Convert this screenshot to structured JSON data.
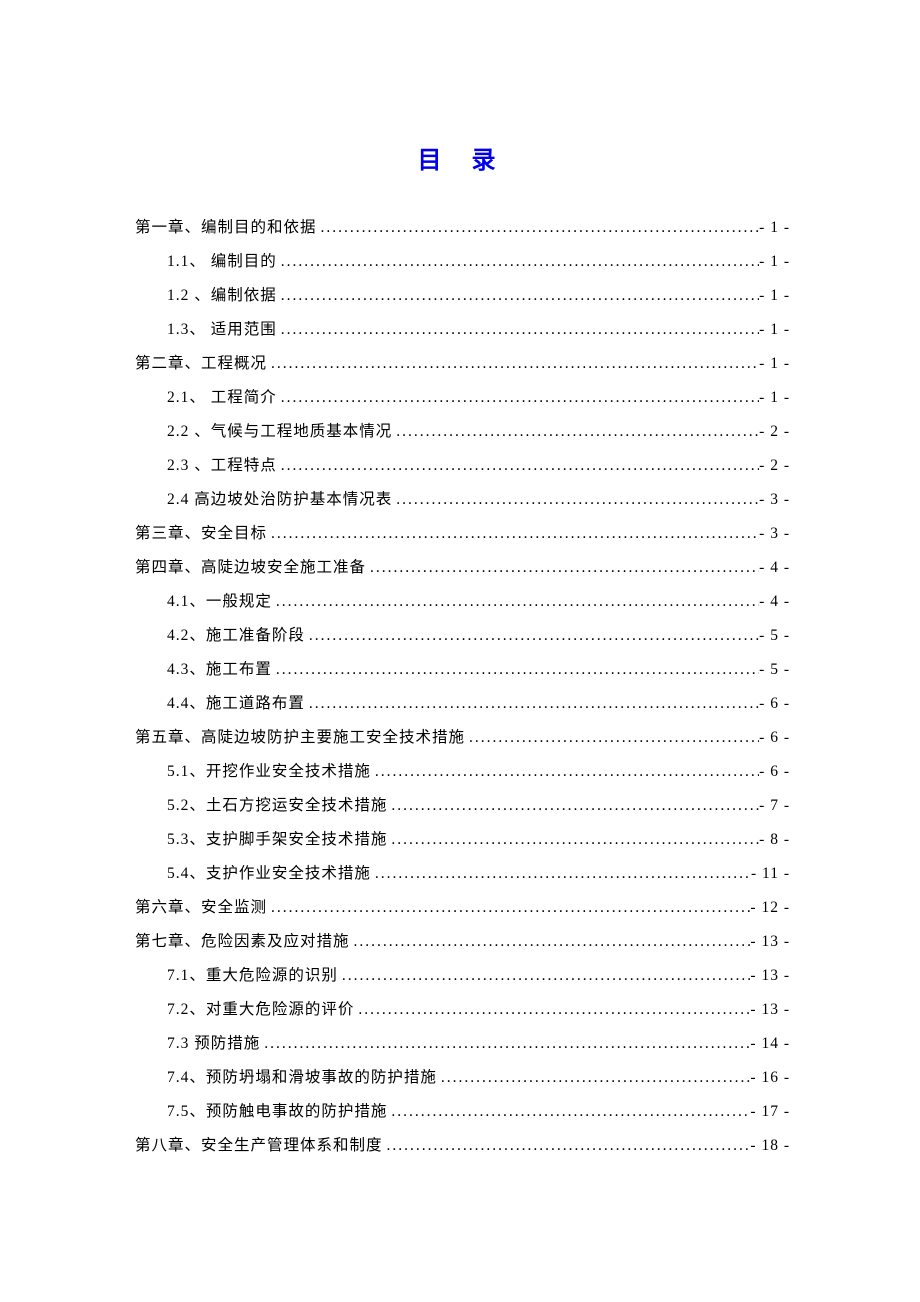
{
  "title": "目 录",
  "entries": [
    {
      "level": 1,
      "label": "第一章、编制目的和依据",
      "page": "- 1 -"
    },
    {
      "level": 2,
      "label": "1.1、 编制目的",
      "page": "- 1 -"
    },
    {
      "level": 2,
      "label": "1.2 、编制依据",
      "page": "- 1 -"
    },
    {
      "level": 2,
      "label": "1.3、 适用范围",
      "page": "- 1 -"
    },
    {
      "level": 1,
      "label": "第二章、工程概况",
      "page": "- 1 -"
    },
    {
      "level": 2,
      "label": "2.1、 工程简介",
      "page": "- 1 -"
    },
    {
      "level": 2,
      "label": "2.2 、气候与工程地质基本情况",
      "page": "- 2 -"
    },
    {
      "level": 2,
      "label": "2.3 、工程特点",
      "page": "- 2 -"
    },
    {
      "level": 2,
      "label": "2.4 高边坡处治防护基本情况表",
      "page": "- 3 -"
    },
    {
      "level": 1,
      "label": "第三章、安全目标",
      "page": "- 3 -"
    },
    {
      "level": 1,
      "label": "第四章、高陡边坡安全施工准备",
      "page": "- 4 -"
    },
    {
      "level": 2,
      "label": "4.1、一般规定",
      "page": "- 4 -"
    },
    {
      "level": 2,
      "label": "4.2、施工准备阶段",
      "page": "- 5 -"
    },
    {
      "level": 2,
      "label": "4.3、施工布置",
      "page": "- 5 -"
    },
    {
      "level": 2,
      "label": "4.4、施工道路布置",
      "page": "- 6 -"
    },
    {
      "level": 1,
      "label": "第五章、高陡边坡防护主要施工安全技术措施",
      "page": "- 6 -"
    },
    {
      "level": 2,
      "label": "5.1、开挖作业安全技术措施",
      "page": "- 6 -"
    },
    {
      "level": 2,
      "label": "5.2、土石方挖运安全技术措施",
      "page": "- 7 -"
    },
    {
      "level": 2,
      "label": "5.3、支护脚手架安全技术措施",
      "page": "- 8 -"
    },
    {
      "level": 2,
      "label": "5.4、支护作业安全技术措施",
      "page": "- 11 -"
    },
    {
      "level": 1,
      "label": "第六章、安全监测",
      "page": "- 12 -"
    },
    {
      "level": 1,
      "label": "第七章、危险因素及应对措施",
      "page": "- 13 -"
    },
    {
      "level": 2,
      "label": "7.1、重大危险源的识别",
      "page": "- 13 -"
    },
    {
      "level": 2,
      "label": "7.2、对重大危险源的评价",
      "page": "- 13 -"
    },
    {
      "level": 2,
      "label": "7.3  预防措施",
      "page": "- 14 -"
    },
    {
      "level": 2,
      "label": "7.4、预防坍塌和滑坡事故的防护措施",
      "page": "- 16 -"
    },
    {
      "level": 2,
      "label": "7.5、预防触电事故的防护措施",
      "page": "- 17 -"
    },
    {
      "level": 1,
      "label": "第八章、安全生产管理体系和制度",
      "page": "- 18 -"
    }
  ]
}
